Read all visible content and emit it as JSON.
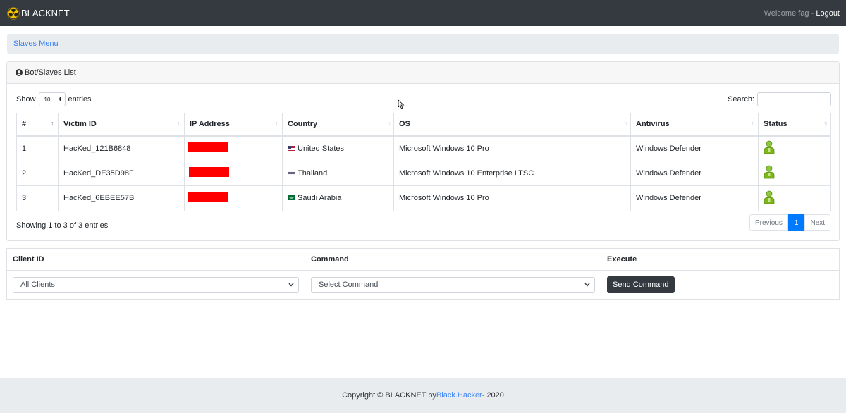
{
  "navbar": {
    "brand": "BLACKNET",
    "welcome": "Welcome fag",
    "separator": " - ",
    "logout": "Logout"
  },
  "breadcrumb": {
    "item": "Slaves Menu"
  },
  "card": {
    "title": "Bot/Slaves List",
    "show_label": "Show",
    "entries_value": "10",
    "entries_label": "entries",
    "search_label": "Search:",
    "columns": [
      "#",
      "Victim ID",
      "IP Address",
      "Country",
      "OS",
      "Antivirus",
      "Status"
    ],
    "rows": [
      {
        "num": "1",
        "victim_id": "HacKed_121B6848",
        "ip": "",
        "country": "United States",
        "country_flag": "us-flag",
        "os": "Microsoft Windows 10 Pro",
        "antivirus": "Windows Defender",
        "status_icon": "user-online-icon"
      },
      {
        "num": "2",
        "victim_id": "HacKed_DE35D98F",
        "ip": "",
        "country": "Thailand",
        "country_flag": "th-flag",
        "os": "Microsoft Windows 10 Enterprise LTSC",
        "antivirus": "Windows Defender",
        "status_icon": "user-online-icon"
      },
      {
        "num": "3",
        "victim_id": "HacKed_6EBEE57B",
        "ip": "",
        "country": "Saudi Arabia",
        "country_flag": "sa-flag",
        "os": "Microsoft Windows 10 Pro",
        "antivirus": "Windows Defender",
        "status_icon": "user-online-icon"
      }
    ],
    "info": "Showing 1 to 3 of 3 entries",
    "pager": {
      "previous": "Previous",
      "current": "1",
      "next": "Next"
    }
  },
  "command": {
    "headers": [
      "Client ID",
      "Command",
      "Execute"
    ],
    "client_select": "All Clients",
    "command_select": "Select Command",
    "send_button": "Send Command"
  },
  "footer": {
    "prefix": "Copyright © BLACKNET by ",
    "link": "Black.Hacker",
    "suffix": " - 2020"
  },
  "colors": {
    "navbar": "#343a40",
    "accent": "#007bff",
    "redaction": "#ff0000",
    "status_green": "#7cb518"
  }
}
